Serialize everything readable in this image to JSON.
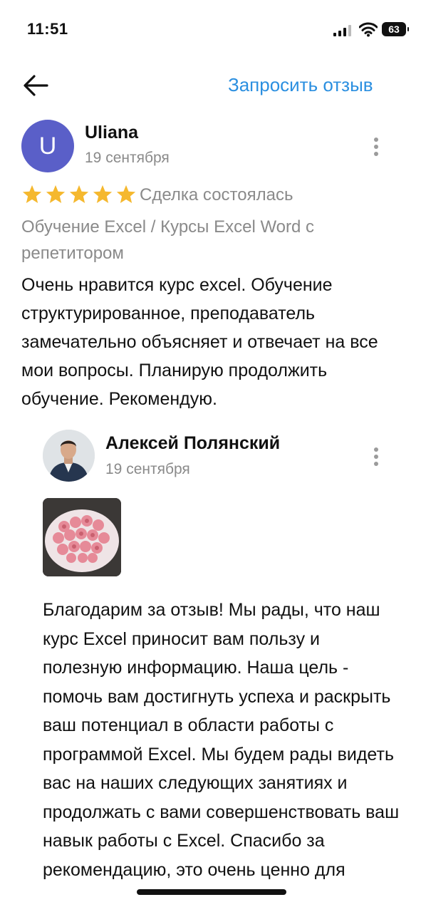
{
  "status_bar": {
    "time": "11:51",
    "battery": "63"
  },
  "header": {
    "request_review_label": "Запросить отзыв"
  },
  "review": {
    "avatar_letter": "U",
    "author": "Uliana",
    "date": "19 сентября",
    "rating": 5,
    "status": "Сделка состоялась",
    "service": "Обучение Excel / Курсы Excel Word с репетитором",
    "text": "Очень нравится курс excel. Обучение структурированное, преподаватель замечательно объясняет и отвечает на все мои вопросы. Планирую продолжить обучение. Рекомендую.",
    "star_color": "#f5b82e"
  },
  "reply": {
    "author": "Алексей Полянский",
    "date": "19 сентября",
    "text": "Благодарим за отзыв! Мы рады, что наш курс Excel приносит вам пользу и полезную информацию. Наша цель - помочь вам достигнуть успеха и раскрыть ваш потенциал в области работы с программой Excel. Мы будем рады видеть вас на наших следующих занятиях и продолжать с вами совершенствовать ваш навык работы с Excel. Спасибо за рекомендацию, это очень ценно для"
  },
  "colors": {
    "accent": "#2b8fe0",
    "avatar_bg": "#5a5fc8",
    "muted": "#8a8a8a"
  }
}
